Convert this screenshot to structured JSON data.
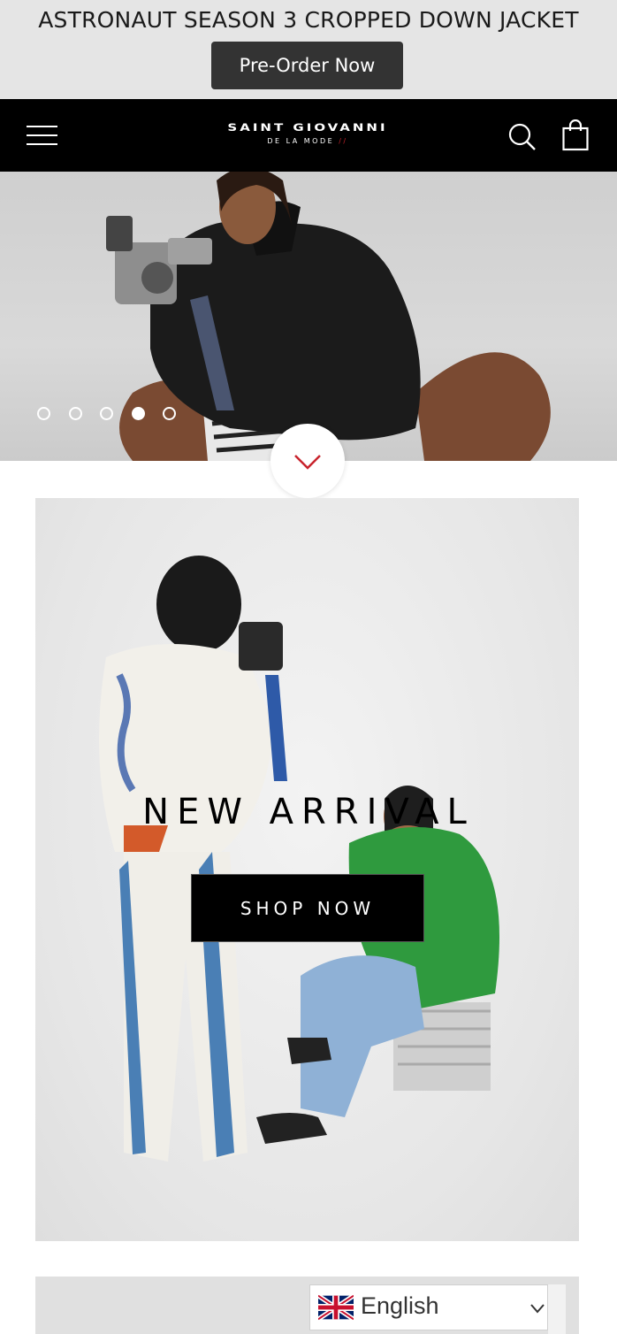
{
  "announcement": {
    "title": "ASTRONAUT SEASON 3 CROPPED DOWN JACKET",
    "button_label": "Pre-Order Now"
  },
  "header": {
    "logo_main": "SAINT GIOVANNI",
    "logo_sub": "DE LA MODE",
    "icons": [
      "menu-icon",
      "search-icon",
      "cart-icon"
    ]
  },
  "slideshow": {
    "slide_count": 5,
    "active_slide": 4
  },
  "promo": {
    "title": "NEW ARRIVAL",
    "button_label": "SHOP NOW"
  },
  "language_selector": {
    "selected": "English",
    "flag": "uk-flag-icon"
  },
  "colors": {
    "announcement_bg": "#e5e5e5",
    "header_bg": "#000000",
    "button_dark": "#333333",
    "accent_red": "#c8232c"
  }
}
